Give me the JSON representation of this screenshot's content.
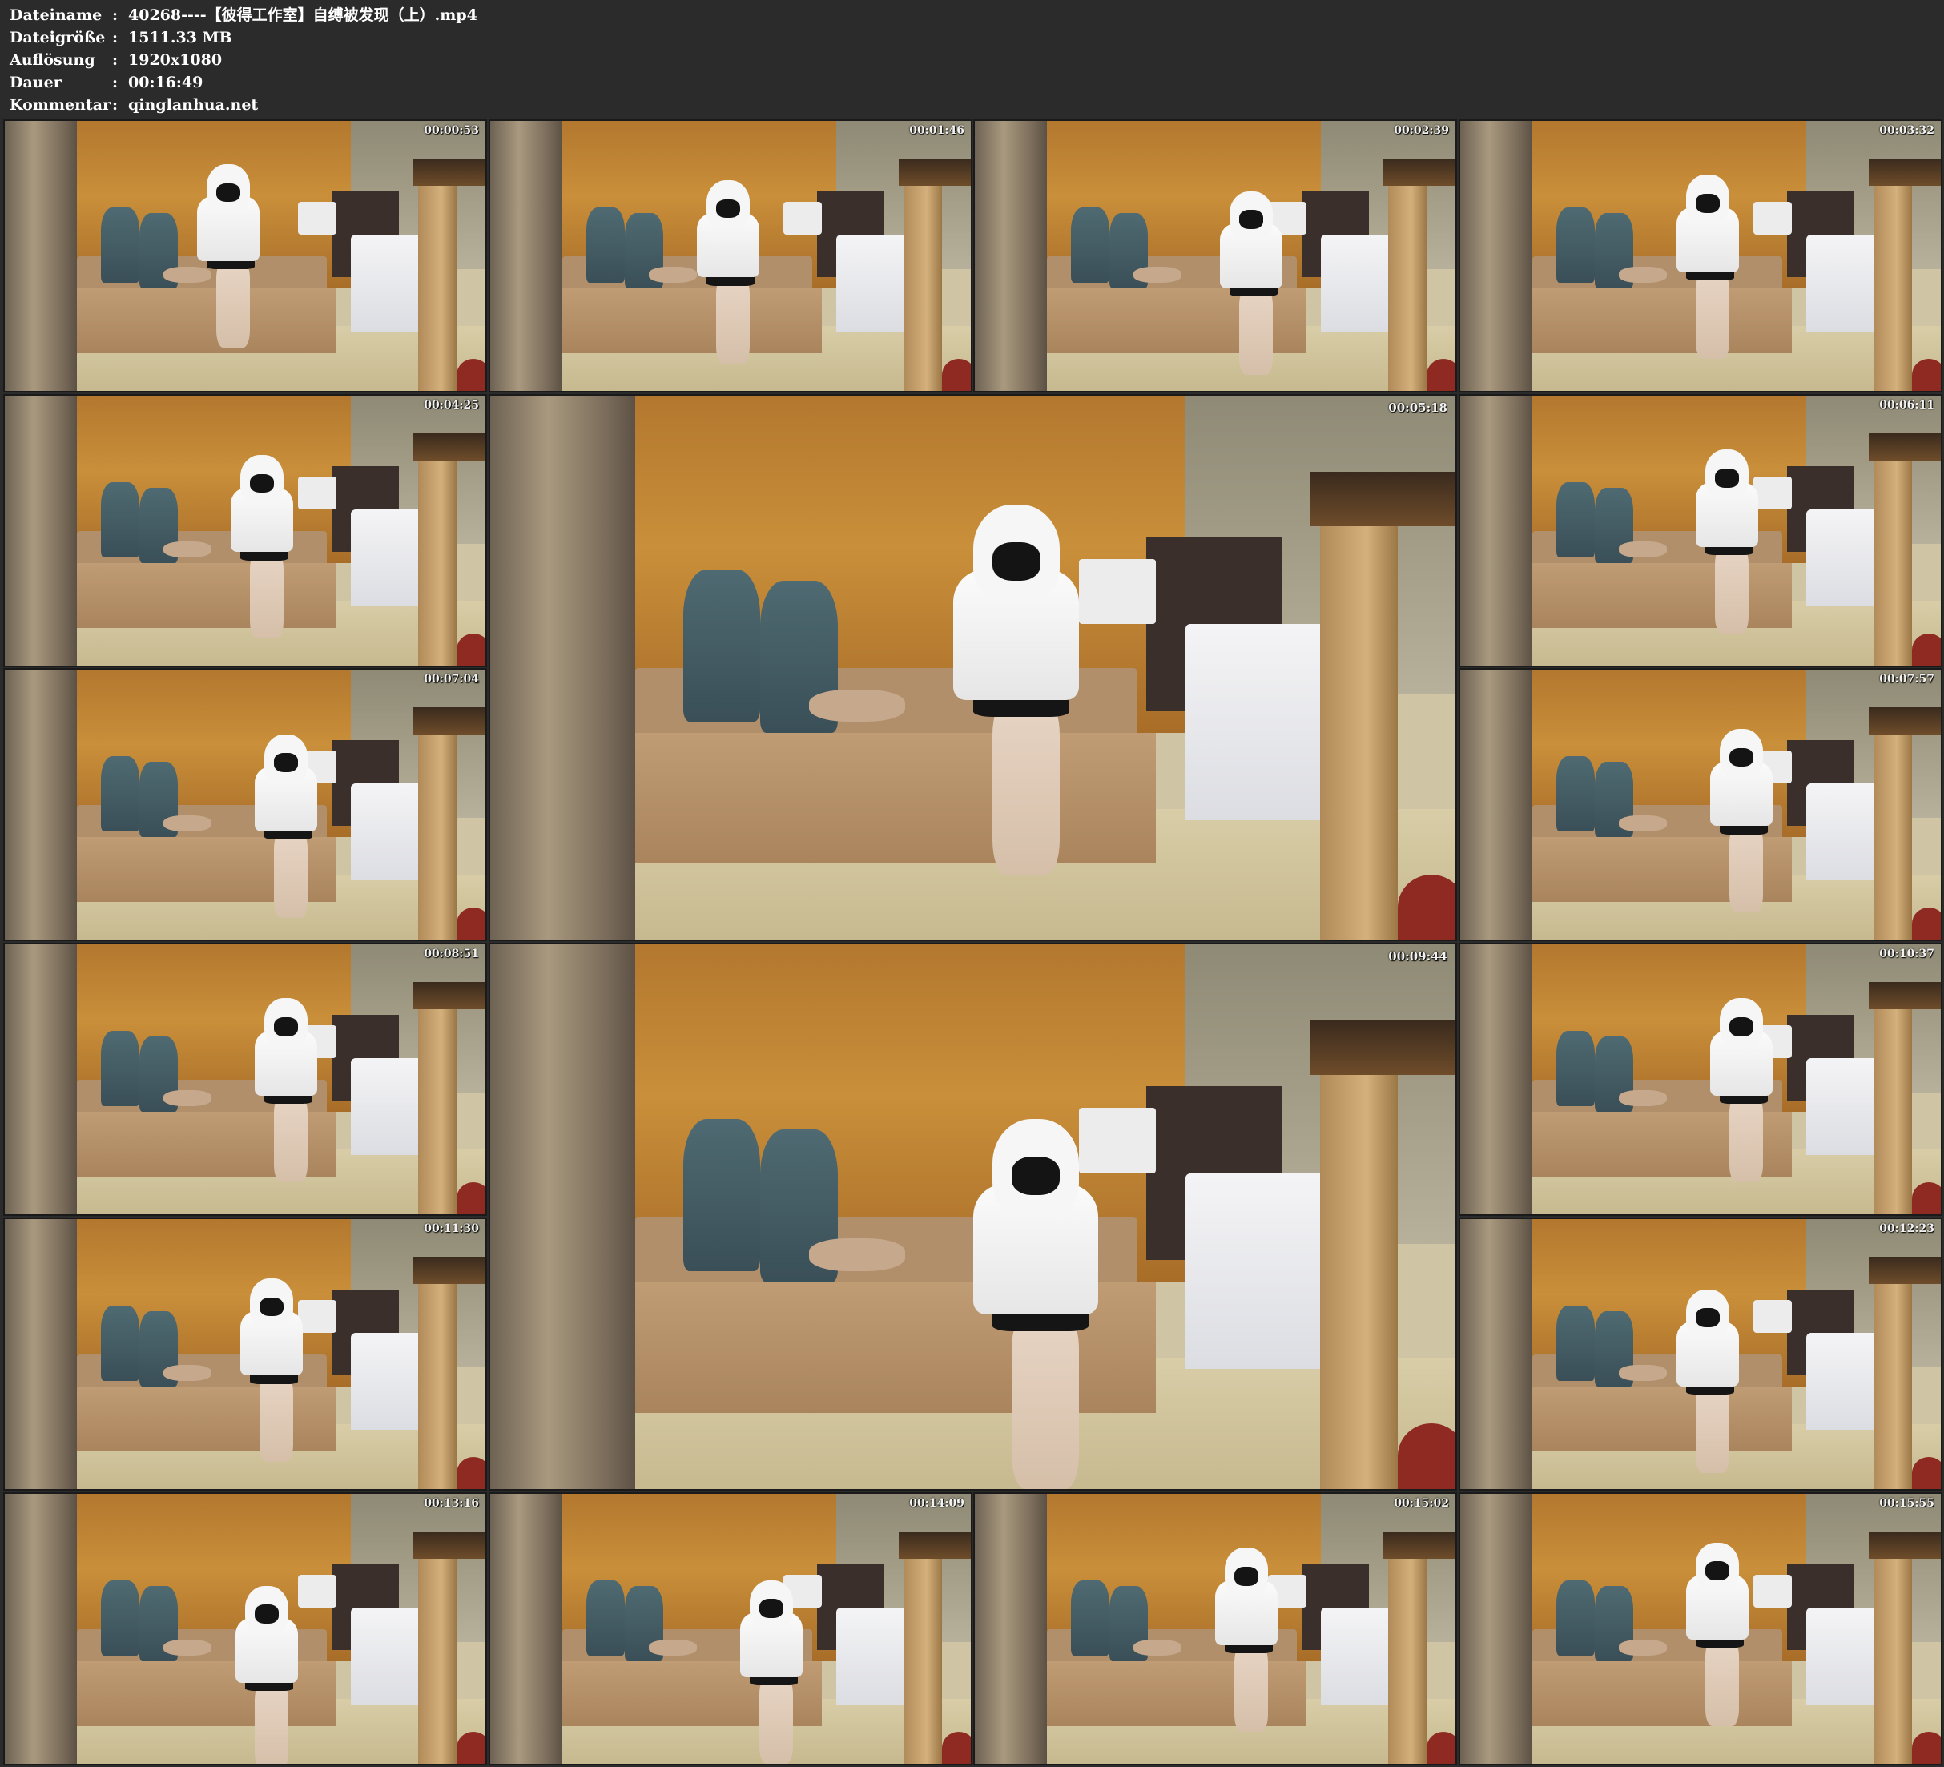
{
  "header": {
    "rows": [
      {
        "label": "Dateiname",
        "sep": ":",
        "value": "40268----【彼得工作室】自缚被发现（上）.mp4"
      },
      {
        "label": "Dateigröße",
        "sep": ":",
        "value": "1511.33 MB"
      },
      {
        "label": "Auflösung",
        "sep": ":",
        "value": "1920x1080"
      },
      {
        "label": "Dauer",
        "sep": ":",
        "value": "00:16:49"
      },
      {
        "label": "Kommentar",
        "sep": ":",
        "value": "qinglanhua.net"
      }
    ]
  },
  "thumbnails": [
    {
      "timestamp": "00:00:53"
    },
    {
      "timestamp": "00:01:46"
    },
    {
      "timestamp": "00:02:39"
    },
    {
      "timestamp": "00:03:32"
    },
    {
      "timestamp": "00:04:25"
    },
    {
      "timestamp": "00:05:18"
    },
    {
      "timestamp": "00:06:11"
    },
    {
      "timestamp": "00:07:04"
    },
    {
      "timestamp": "00:07:57"
    },
    {
      "timestamp": "00:08:51"
    },
    {
      "timestamp": "00:09:44"
    },
    {
      "timestamp": "00:10:37"
    },
    {
      "timestamp": "00:11:30"
    },
    {
      "timestamp": "00:12:23"
    },
    {
      "timestamp": "00:13:16"
    },
    {
      "timestamp": "00:14:09"
    },
    {
      "timestamp": "00:15:02"
    },
    {
      "timestamp": "00:15:55"
    }
  ],
  "colors": {
    "background": "#2b2b2b",
    "header_text": "#ffffff",
    "timestamp_text": "#f2f2f2"
  }
}
